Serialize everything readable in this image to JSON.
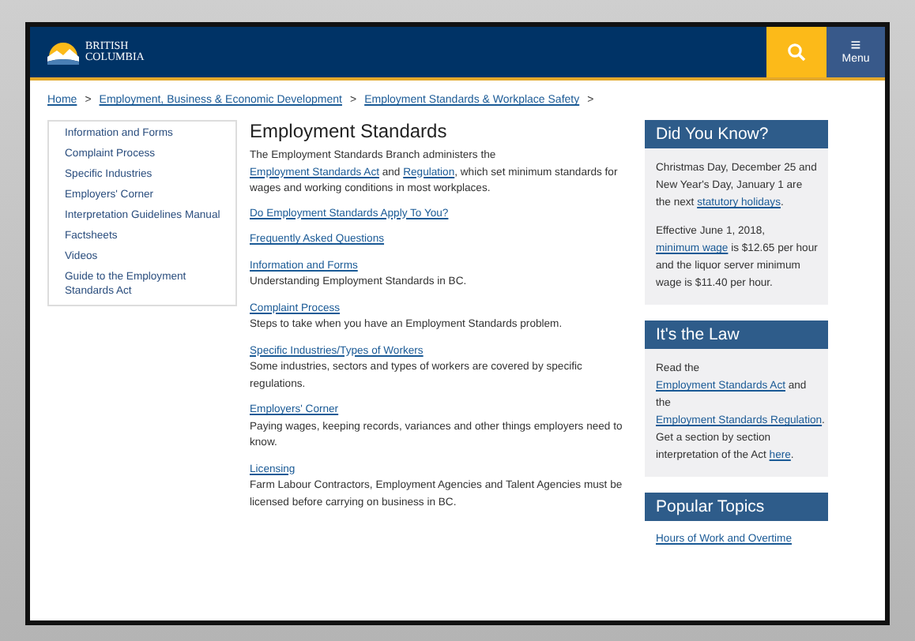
{
  "header": {
    "logo_line1": "BRITISH",
    "logo_line2": "COLUMBIA",
    "menu_label": "Menu",
    "menu_glyph": "≡"
  },
  "breadcrumb": [
    {
      "kind": "link",
      "text": "Home"
    },
    {
      "kind": "sep",
      "text": ">"
    },
    {
      "kind": "link",
      "text": "Employment, Business & Economic Development"
    },
    {
      "kind": "sep",
      "text": ">"
    },
    {
      "kind": "link",
      "text": "Employment Standards & Workplace Safety"
    },
    {
      "kind": "sep",
      "text": ">"
    }
  ],
  "sidebar": {
    "items": [
      "Information and Forms",
      "Complaint Process",
      "Specific Industries",
      "Employers' Corner",
      "Interpretation Guidelines Manual",
      "Factsheets",
      "Videos",
      "Guide to the Employment Standards Act"
    ]
  },
  "main": {
    "title": "Employment Standards",
    "intro": [
      {
        "kind": "text",
        "text": "The Employment Standards Branch administers the "
      },
      {
        "kind": "link",
        "text": "Employment Standards Act"
      },
      {
        "kind": "text",
        "text": " and "
      },
      {
        "kind": "link",
        "text": "Regulation"
      },
      {
        "kind": "text",
        "text": ", which set minimum standards for wages and working conditions in most workplaces."
      }
    ],
    "sections": [
      {
        "link": "Do Employment Standards Apply To You?"
      },
      {
        "link": "Frequently Asked Questions"
      },
      {
        "link": "Information and Forms",
        "description": "Understanding Employment Standards in BC."
      },
      {
        "link": "Complaint Process",
        "description": "Steps to take when you have an Employment Standards problem."
      },
      {
        "link": "Specific Industries/Types of Workers",
        "description": "Some industries, sectors and types of workers are covered by specific regulations."
      },
      {
        "link": "Employers' Corner",
        "description": "Paying wages, keeping records, variances and other things employers need to know."
      },
      {
        "link": "Licensing",
        "description": "Farm Labour Contractors, Employment Agencies and Talent Agencies must be licensed before carrying on business in BC."
      }
    ]
  },
  "aside": [
    {
      "kind": "box",
      "title": "Did You Know?",
      "paragraphs": [
        [
          {
            "kind": "text",
            "text": "Christmas Day, December 25 and New Year's Day, January 1 are the next "
          },
          {
            "kind": "link",
            "text": "statutory holidays"
          },
          {
            "kind": "text",
            "text": "."
          }
        ],
        [
          {
            "kind": "text",
            "text": "Effective June 1, 2018, "
          },
          {
            "kind": "link",
            "text": "minimum wage"
          },
          {
            "kind": "text",
            "text": " is $12.65 per hour and the liquor server minimum wage is $11.40 per hour."
          }
        ]
      ]
    },
    {
      "kind": "box",
      "title": "It's the Law",
      "paragraphs": [
        [
          {
            "kind": "text",
            "text": "Read the "
          },
          {
            "kind": "link",
            "text": "Employment Standards Act"
          },
          {
            "kind": "text",
            "text": " and the "
          },
          {
            "kind": "link",
            "text": "Employment Standards Regulation"
          },
          {
            "kind": "text",
            "text": ". Get a section by section interpretation of the Act "
          },
          {
            "kind": "link",
            "text": "here"
          },
          {
            "kind": "text",
            "text": "."
          }
        ]
      ]
    },
    {
      "kind": "list",
      "title": "Popular Topics",
      "links": [
        "Hours of Work and Overtime"
      ]
    }
  ]
}
